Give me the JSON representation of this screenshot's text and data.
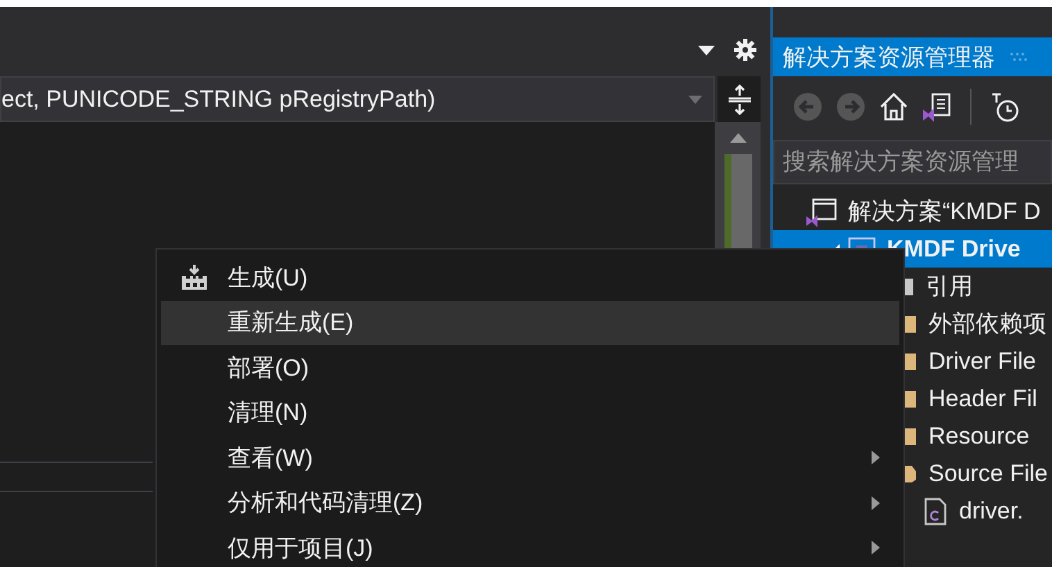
{
  "editor": {
    "navigation_bar": {
      "value": "ect, PUNICODE_STRING pRegistryPath)"
    }
  },
  "solution_explorer": {
    "title": "解决方案资源管理器",
    "search": {
      "placeholder": "搜索解决方案资源管理"
    },
    "tree": [
      {
        "label": "解决方案“KMDF D",
        "kind": "solution",
        "selected": false,
        "expanded": true,
        "children": [
          {
            "label": "KMDF Drive",
            "kind": "project",
            "selected": true,
            "expanded": true,
            "children": [
              {
                "label": "引用",
                "kind": "references",
                "selected": false
              },
              {
                "label": "外部依赖项",
                "kind": "folder",
                "selected": false
              },
              {
                "label": "Driver File",
                "kind": "folder",
                "selected": false
              },
              {
                "label": "Header Fil",
                "kind": "folder",
                "selected": false
              },
              {
                "label": "Resource",
                "kind": "folder",
                "selected": false
              },
              {
                "label": "Source File",
                "kind": "folder",
                "selected": false,
                "expanded": true,
                "children": [
                  {
                    "label": "driver.",
                    "kind": "c-file",
                    "selected": false
                  }
                ]
              }
            ]
          }
        ]
      }
    ]
  },
  "context_menu": {
    "items": [
      {
        "label": "生成(U)",
        "has_icon": true,
        "has_submenu": false,
        "selected": false
      },
      {
        "label": "重新生成(E)",
        "has_icon": false,
        "has_submenu": false,
        "selected": true
      },
      {
        "label": "部署(O)",
        "has_icon": false,
        "has_submenu": false,
        "selected": false
      },
      {
        "label": "清理(N)",
        "has_icon": false,
        "has_submenu": false,
        "selected": false
      },
      {
        "label": "查看(W)",
        "has_icon": false,
        "has_submenu": true,
        "selected": false
      },
      {
        "label": "分析和代码清理(Z)",
        "has_icon": false,
        "has_submenu": true,
        "selected": false
      },
      {
        "label": "仅用于项目(J)",
        "has_icon": false,
        "has_submenu": true,
        "selected": false
      }
    ]
  }
}
